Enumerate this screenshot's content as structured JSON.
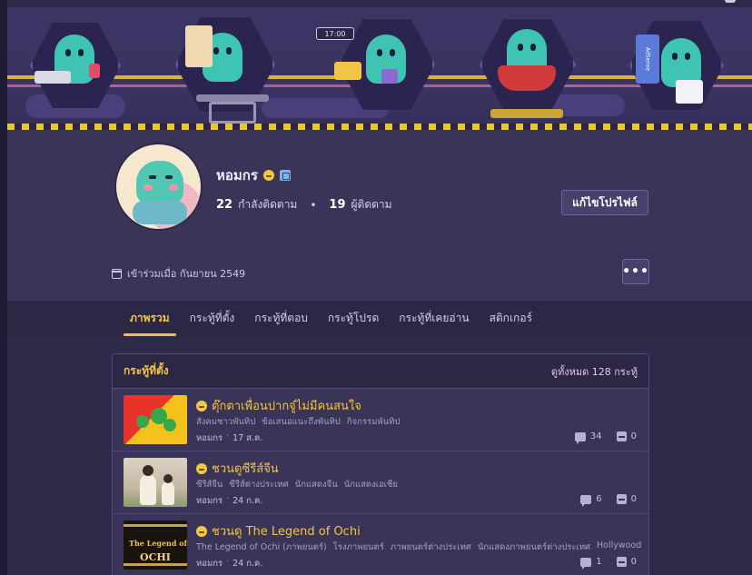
{
  "profile": {
    "username": "หอมกร",
    "following_count": "22",
    "following_label": "กำลังติดตาม",
    "followers_count": "19",
    "followers_label": "ผู้ติดตาม",
    "edit_label": "แก้ไขโปรไฟล์",
    "joined_text": "เข้าร่วมเมื่อ กันยายน 2549",
    "more_label": "•••"
  },
  "tabs": [
    {
      "label": "ภาพรวม"
    },
    {
      "label": "กระทู้ที่ตั้ง"
    },
    {
      "label": "กระทู้ที่ตอบ"
    },
    {
      "label": "กระทู้โปรด"
    },
    {
      "label": "กระทู้ที่เคยอ่าน"
    },
    {
      "label": "สติกเกอร์"
    }
  ],
  "active_tab": "ภาพรวม",
  "posts_card": {
    "title": "กระทู้ที่ตั้ง",
    "view_all": "ดูทั้งหมด 128 กระทู้",
    "topics": [
      {
        "title": "ตุ๊กตาเพื่อนปากจู๋ไม่มีคนสนใจ",
        "tags": [
          "สังคมชาวพันทิป",
          "ข้อเสนอแนะถึงพันทิป",
          "กิจกรรมพันทิป"
        ],
        "author": "หอมกร",
        "date": "17 ส.ค.",
        "comments": "34",
        "votes": "0"
      },
      {
        "title": "ชวนดูซีรีส์จีน",
        "tags": [
          "ซีรีส์จีน",
          "ซีรีส์ต่างประเทศ",
          "นักแสดงจีน",
          "นักแสดงเอเชีย"
        ],
        "author": "หอมกร",
        "date": "24 ก.ค.",
        "comments": "6",
        "votes": "0"
      },
      {
        "title": "ชวนดู The Legend of Ochi",
        "tags": [
          "The Legend of Ochi (ภาพยนตร์)",
          "โรงภาพยนตร์",
          "ภาพยนตร์ต่างประเทศ",
          "นักแสดงภาพยนตร์ต่างประเทศ",
          "Hollywood"
        ],
        "author": "หอมกร",
        "date": "24 ก.ค.",
        "comments": "1",
        "votes": "0",
        "thumb_text_1": "The Legend of",
        "thumb_text_2": "OCHI"
      }
    ]
  },
  "banner": {
    "clock_text": "17:00",
    "adsense_text": "AdSense"
  },
  "colors": {
    "background": "#2d2a4a",
    "accent": "#f2c443",
    "card": "#3a3458"
  }
}
